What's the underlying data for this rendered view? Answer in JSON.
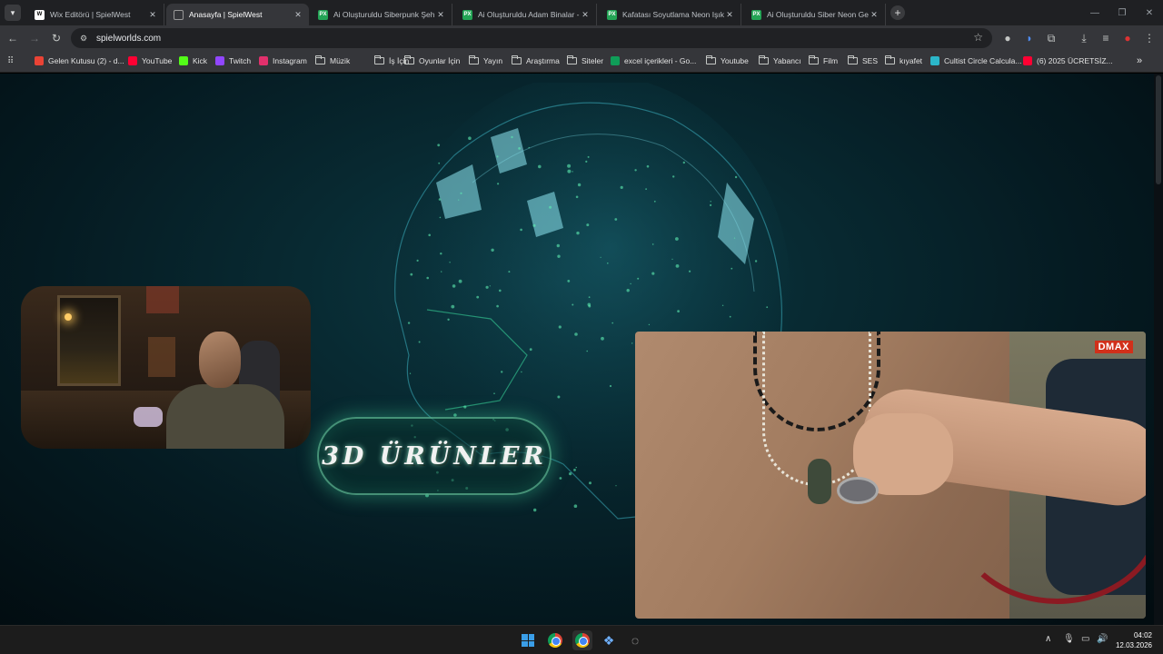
{
  "browser": {
    "tabs": [
      {
        "title": "Wix Editörü | SpielWest",
        "favicon": "wix-icon",
        "active": false
      },
      {
        "title": "Anasayfa | SpielWest",
        "favicon": "spielwest-icon",
        "active": true
      },
      {
        "title": "Ai Oluşturuldu Siberpunk Şehir",
        "favicon": "px-icon",
        "active": false
      },
      {
        "title": "Ai Oluşturuldu Adam Binalar -",
        "favicon": "px-icon",
        "active": false
      },
      {
        "title": "Kafatası Soyutlama Neon Işık -",
        "favicon": "px-icon",
        "active": false
      },
      {
        "title": "Ai Oluşturuldu Siber Neon Ge",
        "favicon": "px-icon",
        "active": false
      }
    ],
    "url": "spielworlds.com",
    "bookmarks": [
      {
        "label": "Gelen Kutusu (2) - d...",
        "icon": "gmail-icon",
        "color": "#ea4335"
      },
      {
        "label": "YouTube",
        "icon": "youtube-icon",
        "color": "#ff0033"
      },
      {
        "label": "Kick",
        "icon": "kick-icon",
        "color": "#53fc18"
      },
      {
        "label": "Twitch",
        "icon": "twitch-icon",
        "color": "#9146ff"
      },
      {
        "label": "Instagram",
        "icon": "instagram-icon",
        "color": "#e1306c"
      },
      {
        "label": "Müzik",
        "icon": "folder-icon"
      },
      {
        "label": "İş İçin",
        "icon": "folder-icon"
      },
      {
        "label": "Oyunlar İçin",
        "icon": "folder-icon"
      },
      {
        "label": "Yayın",
        "icon": "folder-icon"
      },
      {
        "label": "Araştırma",
        "icon": "folder-icon"
      },
      {
        "label": "Siteler",
        "icon": "folder-icon"
      },
      {
        "label": "excel içerikleri - Go...",
        "icon": "sheets-icon",
        "color": "#0f9d58"
      },
      {
        "label": "Youtube",
        "icon": "folder-icon"
      },
      {
        "label": "Yabancı",
        "icon": "folder-icon"
      },
      {
        "label": "Film",
        "icon": "folder-icon"
      },
      {
        "label": "SES",
        "icon": "folder-icon"
      },
      {
        "label": "kıyafet",
        "icon": "folder-icon"
      },
      {
        "label": "Cultist Circle Calcula...",
        "icon": "cultist-icon",
        "color": "#2bb6c9"
      },
      {
        "label": "(6) 2025 ÜCRETSİZ...",
        "icon": "youtube-icon",
        "color": "#ff0033"
      }
    ]
  },
  "page": {
    "cta_label": "3D ÜRÜNLER",
    "video_logo": "DMAX",
    "accent": "#5fe0b0",
    "bg": "#062a33"
  },
  "taskbar": {
    "apps": [
      "start-icon",
      "chrome-icon",
      "chrome-icon",
      "app-icon",
      "app-icon"
    ],
    "time": "04:02",
    "date": "12.03.2026"
  }
}
